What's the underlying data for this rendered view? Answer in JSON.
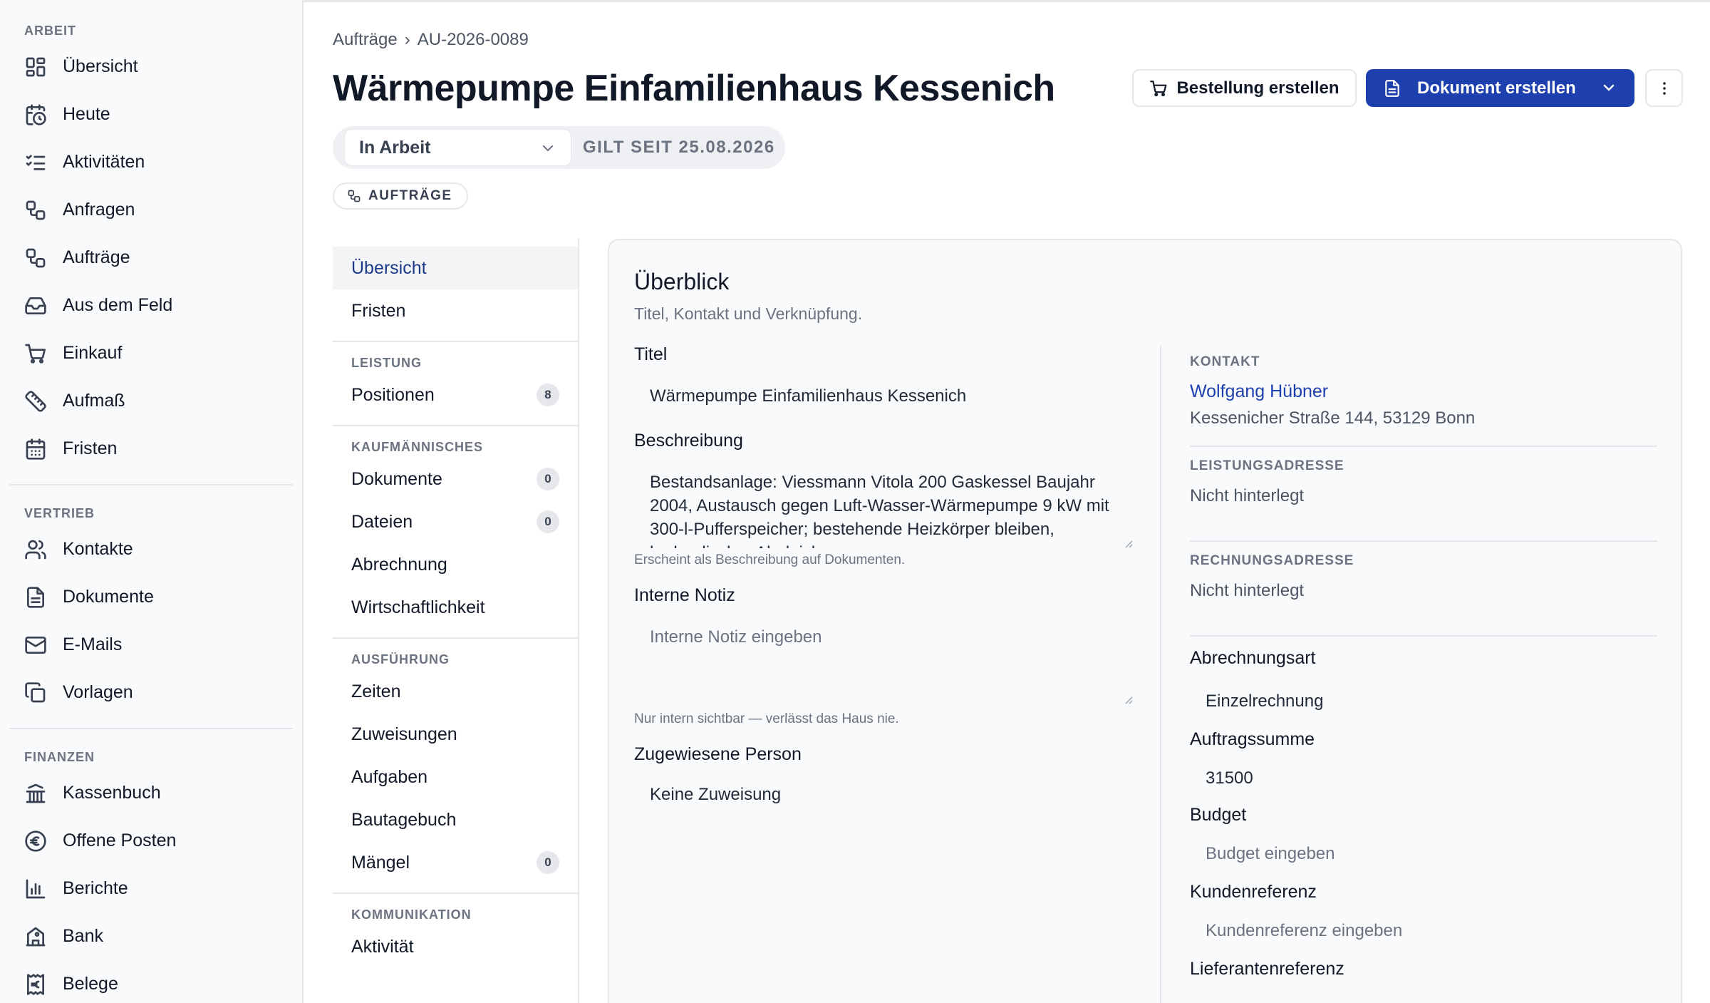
{
  "sidebar": {
    "sections": [
      {
        "label": "ARBEIT",
        "items": [
          {
            "label": "Übersicht",
            "icon": "dashboard-icon"
          },
          {
            "label": "Heute",
            "icon": "calendar-clock-icon"
          },
          {
            "label": "Aktivitäten",
            "icon": "list-checks-icon"
          },
          {
            "label": "Anfragen",
            "icon": "workflow-icon"
          },
          {
            "label": "Aufträge",
            "icon": "workflow-icon"
          },
          {
            "label": "Aus dem Feld",
            "icon": "inbox-icon"
          },
          {
            "label": "Einkauf",
            "icon": "cart-icon"
          },
          {
            "label": "Aufmaß",
            "icon": "ruler-icon"
          },
          {
            "label": "Fristen",
            "icon": "calendar-icon"
          }
        ]
      },
      {
        "label": "VERTRIEB",
        "items": [
          {
            "label": "Kontakte",
            "icon": "users-icon"
          },
          {
            "label": "Dokumente",
            "icon": "document-icon"
          },
          {
            "label": "E-Mails",
            "icon": "mail-icon"
          },
          {
            "label": "Vorlagen",
            "icon": "copy-icon"
          }
        ]
      },
      {
        "label": "FINANZEN",
        "items": [
          {
            "label": "Kassenbuch",
            "icon": "bank-icon"
          },
          {
            "label": "Offene Posten",
            "icon": "euro-circle-icon"
          },
          {
            "label": "Berichte",
            "icon": "bar-chart-icon"
          },
          {
            "label": "Bank",
            "icon": "bank-building-icon"
          },
          {
            "label": "Belege",
            "icon": "receipt-euro-icon"
          }
        ]
      }
    ]
  },
  "header": {
    "breadcrumb_parent": "Aufträge",
    "breadcrumb_separator": "›",
    "breadcrumb_current": "AU-2026-0089",
    "title": "Wärmepumpe Einfamilienhaus Kessenich",
    "order_button": "Bestellung erstellen",
    "document_button": "Dokument erstellen",
    "status": "In Arbeit",
    "status_since": "GILT SEIT 25.08.2026",
    "tag": "AUFTRÄGE"
  },
  "subnav": {
    "groups": [
      {
        "label": "",
        "items": [
          {
            "label": "Übersicht",
            "active": true,
            "badge": ""
          },
          {
            "label": "Fristen",
            "badge": ""
          }
        ]
      },
      {
        "label": "LEISTUNG",
        "items": [
          {
            "label": "Positionen",
            "badge": "8"
          }
        ]
      },
      {
        "label": "KAUFMÄNNISCHES",
        "items": [
          {
            "label": "Dokumente",
            "badge": "0"
          },
          {
            "label": "Dateien",
            "badge": "0"
          },
          {
            "label": "Abrechnung",
            "badge": ""
          },
          {
            "label": "Wirtschaftlichkeit",
            "badge": ""
          }
        ]
      },
      {
        "label": "AUSFÜHRUNG",
        "items": [
          {
            "label": "Zeiten",
            "badge": ""
          },
          {
            "label": "Zuweisungen",
            "badge": ""
          },
          {
            "label": "Aufgaben",
            "badge": ""
          },
          {
            "label": "Bautagebuch",
            "badge": ""
          },
          {
            "label": "Mängel",
            "badge": "0"
          }
        ]
      },
      {
        "label": "KOMMUNIKATION",
        "items": [
          {
            "label": "Aktivität",
            "badge": ""
          }
        ]
      }
    ]
  },
  "overview": {
    "title": "Überblick",
    "subtitle": "Titel, Kontakt und Verknüpfung.",
    "title_label": "Titel",
    "title_value": "Wärmepumpe Einfamilienhaus Kessenich",
    "description_label": "Beschreibung",
    "description_value": "Bestandsanlage: Viessmann Vitola 200 Gaskessel Baujahr 2004, Austausch gegen Luft-Wasser-Wärmepumpe 9 kW mit 300-l-Pufferspeicher; bestehende Heizkörper bleiben, hydraulischer Abgleich",
    "description_hint": "Erscheint als Beschreibung auf Dokumenten.",
    "note_label": "Interne Notiz",
    "note_placeholder": "Interne Notiz eingeben",
    "note_hint": "Nur intern sichtbar — verlässt das Haus nie.",
    "assignee_label": "Zugewiesene Person",
    "assignee_value": "Keine Zuweisung"
  },
  "details": {
    "contact_label": "KONTAKT",
    "contact_name": "Wolfgang Hübner",
    "contact_address": "Kessenicher Straße 144, 53129 Bonn",
    "service_address_label": "LEISTUNGSADRESSE",
    "service_address_value": "Nicht hinterlegt",
    "billing_address_label": "RECHNUNGSADRESSE",
    "billing_address_value": "Nicht hinterlegt",
    "billing_type_label": "Abrechnungsart",
    "billing_type_value": "Einzelrechnung",
    "order_sum_label": "Auftragssumme",
    "order_sum_value": "31500",
    "budget_label": "Budget",
    "budget_placeholder": "Budget eingeben",
    "customer_ref_label": "Kundenreferenz",
    "customer_ref_placeholder": "Kundenreferenz eingeben",
    "supplier_ref_label": "Lieferantenreferenz"
  }
}
